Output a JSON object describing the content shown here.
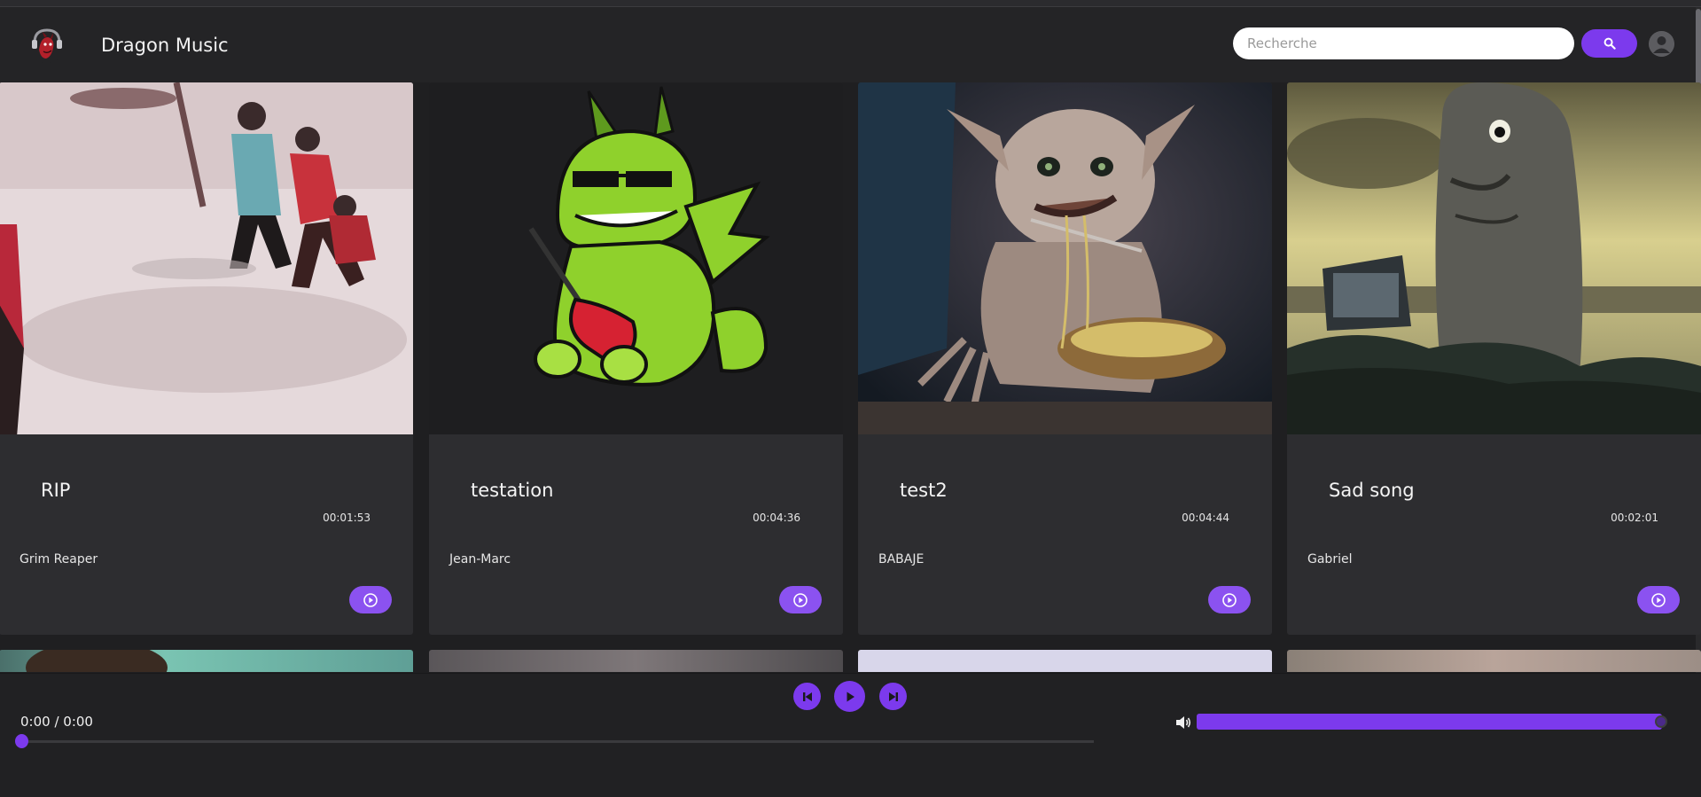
{
  "app": {
    "title": "Dragon Music",
    "logo_icon": "dragon-headphones-logo"
  },
  "search": {
    "placeholder": "Recherche",
    "value": "",
    "button_icon": "search-icon"
  },
  "account": {
    "icon": "user-avatar-icon"
  },
  "colors": {
    "accent": "#7c3aed",
    "card_bg": "#2d2d30",
    "page_bg": "#1f1f21"
  },
  "songs": [
    {
      "title": "RIP",
      "duration": "00:01:53",
      "artist": "Grim Reaper",
      "play_icon": "play-circle-icon"
    },
    {
      "title": "testation",
      "duration": "00:04:36",
      "artist": "Jean-Marc",
      "play_icon": "play-circle-icon"
    },
    {
      "title": "test2",
      "duration": "00:04:44",
      "artist": "BABAJE",
      "play_icon": "play-circle-icon"
    },
    {
      "title": "Sad song",
      "duration": "00:02:01",
      "artist": "Gabriel",
      "play_icon": "play-circle-icon"
    }
  ],
  "player": {
    "time": "0:00 / 0:00",
    "progress_fraction": 0,
    "volume_fraction": 1,
    "icons": [
      "skip-previous-icon",
      "play-icon",
      "skip-next-icon",
      "volume-icon"
    ]
  }
}
